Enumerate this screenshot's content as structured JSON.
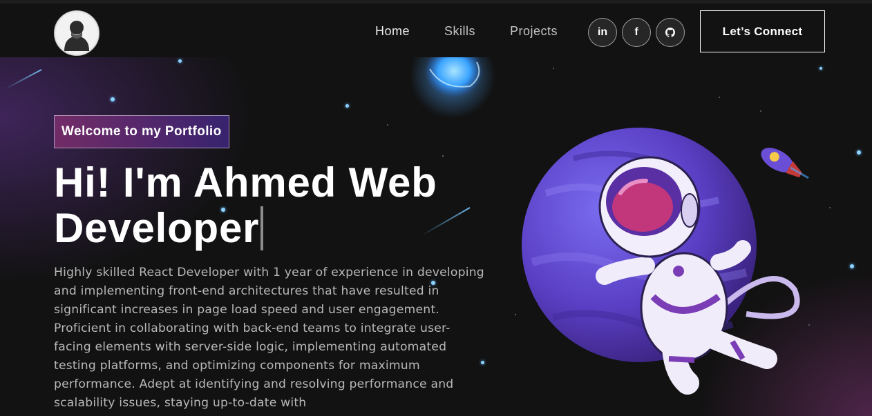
{
  "nav": {
    "logo_alt": "avatar logo",
    "links": [
      {
        "label": "Home"
      },
      {
        "label": "Skills"
      },
      {
        "label": "Projects"
      }
    ],
    "social": [
      {
        "icon": "linkedin-icon",
        "glyph": "in"
      },
      {
        "icon": "facebook-icon",
        "glyph": "f"
      },
      {
        "icon": "github-icon",
        "glyph": ""
      }
    ],
    "connect_label": "Let’s Connect"
  },
  "hero": {
    "tagline": "Welcome to my Portfolio",
    "headline": "Hi! I'm Ahmed Web Developer",
    "description": "Highly skilled React Developer with 1 year of experience in developing and implementing front-end architectures that have resulted in significant increases in page load speed and user engagement. Proficient in collaborating with back-end teams to integrate user-facing elements with server-side logic, implementing automated testing platforms, and optimizing components for maximum performance. Adept at identifying and resolving performance and scalability issues, staying up-to-date with"
  },
  "colors": {
    "background": "#121212",
    "tagline_gradient_start": "#aa367c",
    "tagline_gradient_end": "#4a2fbd",
    "planet": "#6a4fd6",
    "astronaut_visor": "#c2367c"
  }
}
